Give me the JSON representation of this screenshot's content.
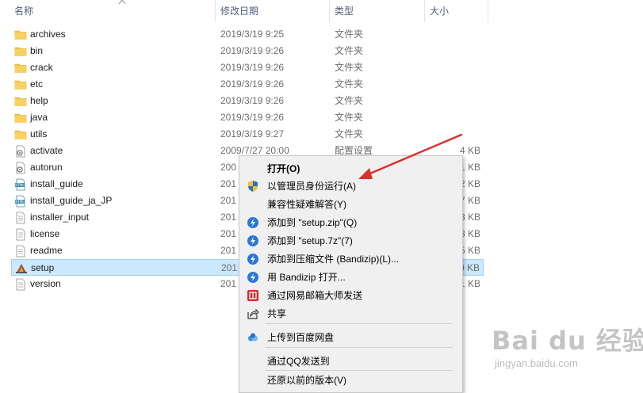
{
  "header": {
    "columns": [
      {
        "label": "名称"
      },
      {
        "label": "修改日期"
      },
      {
        "label": "类型"
      },
      {
        "label": "大小"
      }
    ]
  },
  "files": [
    {
      "name": "archives",
      "date": "2019/3/19 9:25",
      "type": "文件夹",
      "size": "",
      "icon": "folder-icon"
    },
    {
      "name": "bin",
      "date": "2019/3/19 9:26",
      "type": "文件夹",
      "size": "",
      "icon": "folder-icon"
    },
    {
      "name": "crack",
      "date": "2019/3/19 9:26",
      "type": "文件夹",
      "size": "",
      "icon": "folder-icon"
    },
    {
      "name": "etc",
      "date": "2019/3/19 9:26",
      "type": "文件夹",
      "size": "",
      "icon": "folder-icon"
    },
    {
      "name": "help",
      "date": "2019/3/19 9:26",
      "type": "文件夹",
      "size": "",
      "icon": "folder-icon"
    },
    {
      "name": "java",
      "date": "2019/3/19 9:26",
      "type": "文件夹",
      "size": "",
      "icon": "folder-icon"
    },
    {
      "name": "utils",
      "date": "2019/3/19 9:27",
      "type": "文件夹",
      "size": "",
      "icon": "folder-icon"
    },
    {
      "name": "activate",
      "date": "2009/7/27 20:00",
      "type": "配置设置",
      "size": "4 KB",
      "icon": "config-file-icon"
    },
    {
      "name": "autorun",
      "date": "200",
      "type": "",
      "size": "1 KB",
      "icon": "config-file-icon"
    },
    {
      "name": "install_guide",
      "date": "201",
      "type": "",
      "size": "2 KB",
      "icon": "html-file-icon"
    },
    {
      "name": "install_guide_ja_JP",
      "date": "201",
      "type": "",
      "size": "7 KB",
      "icon": "html-file-icon"
    },
    {
      "name": "installer_input",
      "date": "201",
      "type": "",
      "size": "8 KB",
      "icon": "text-file-icon"
    },
    {
      "name": "license",
      "date": "201",
      "type": "",
      "size": "8 KB",
      "icon": "text-file-icon"
    },
    {
      "name": "readme",
      "date": "201",
      "type": "",
      "size": "5 KB",
      "icon": "text-file-icon"
    },
    {
      "name": "setup",
      "date": "201",
      "type": "",
      "size": "0 KB",
      "icon": "setup-icon",
      "selected": true
    },
    {
      "name": "version",
      "date": "201",
      "type": "",
      "size": "1 KB",
      "icon": "text-file-icon"
    }
  ],
  "context_menu": {
    "items": [
      {
        "label": "打开(O)",
        "bold": true,
        "icon": ""
      },
      {
        "label": "以管理员身份运行(A)",
        "icon": "uac-shield-icon"
      },
      {
        "label": "兼容性疑难解答(Y)",
        "icon": ""
      },
      {
        "label": "添加到 \"setup.zip\"(Q)",
        "icon": "bandizip-icon"
      },
      {
        "label": "添加到 \"setup.7z\"(7)",
        "icon": "bandizip-icon"
      },
      {
        "label": "添加到压缩文件 (Bandizip)(L)...",
        "icon": "bandizip-icon"
      },
      {
        "label": "用 Bandizip 打开...",
        "icon": "bandizip-icon"
      },
      {
        "label": "通过网易邮箱大师发送",
        "icon": "netease-mail-icon"
      },
      {
        "label": "共享",
        "icon": "share-icon"
      },
      {
        "label": "上传到百度网盘",
        "icon": "baidu-netdisk-icon"
      },
      {
        "label": "通过QQ发送到",
        "icon": ""
      },
      {
        "label": "还原以前的版本(V)",
        "icon": ""
      }
    ]
  },
  "watermark": {
    "main": "Bai du 经验",
    "sub": "jingyan.baidu.com"
  },
  "colors": {
    "selection_bg": "#cce8ff",
    "folder": "#f4c542",
    "annotation_arrow": "#d93030",
    "bandizip": "#2a78d6"
  }
}
